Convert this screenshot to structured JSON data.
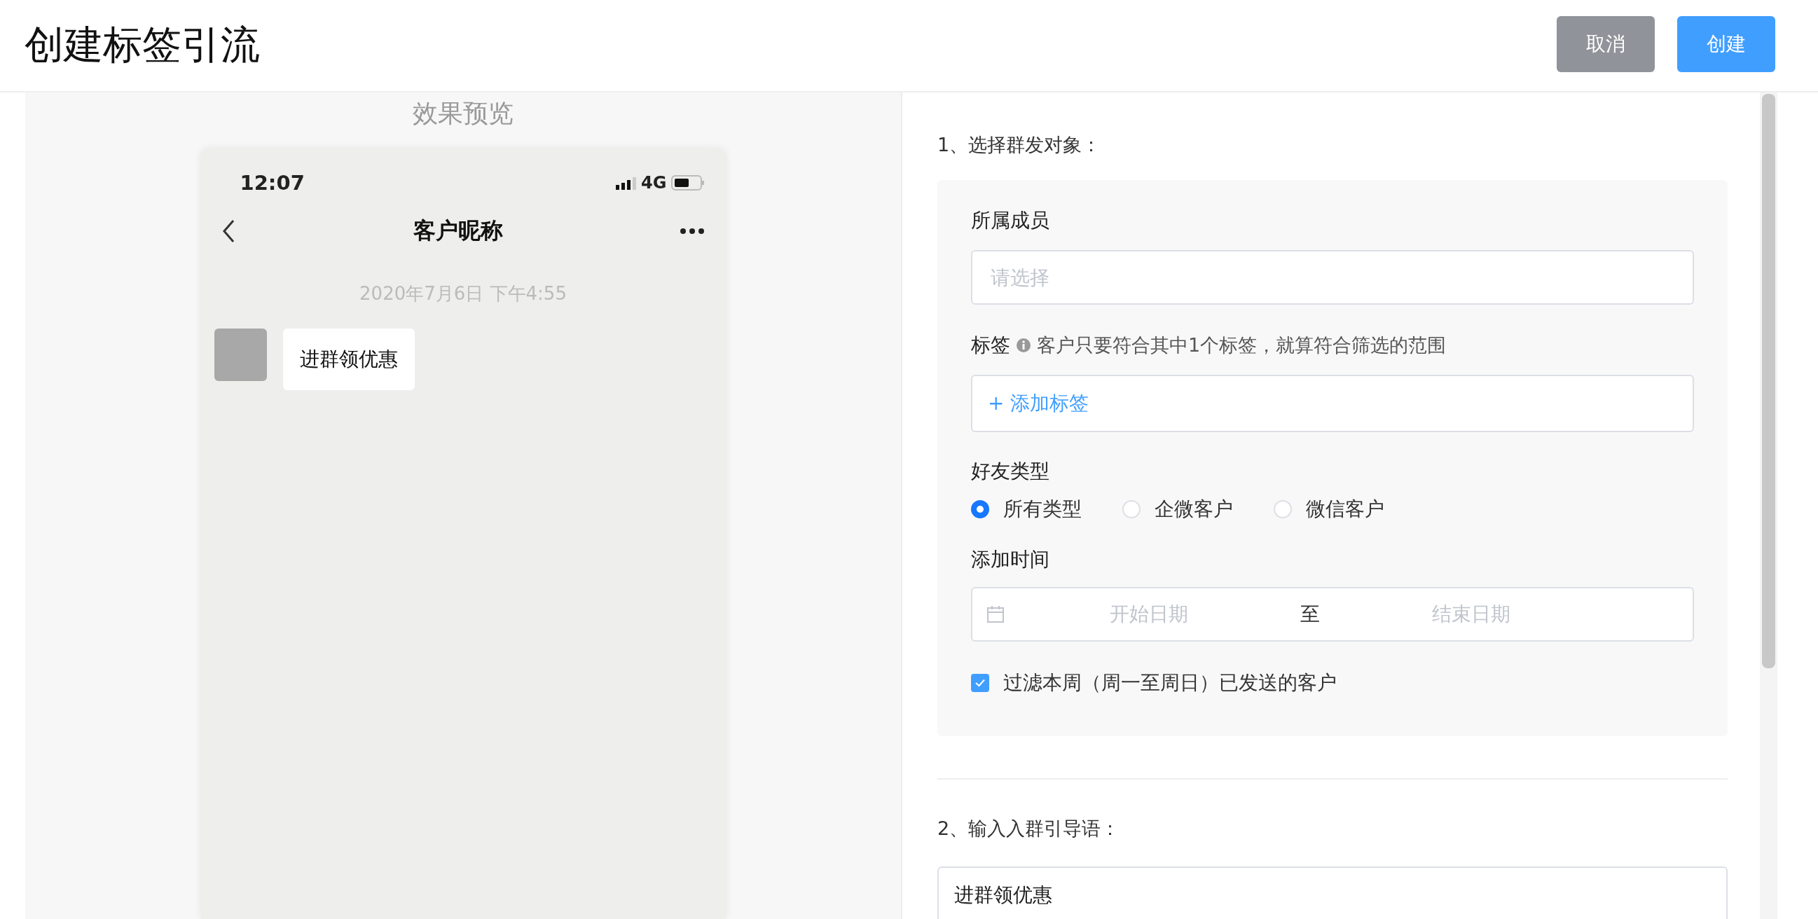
{
  "title": "创建标签引流",
  "buttons": [
    {
      "label": "取消",
      "kind": "cancel"
    },
    {
      "label": "创建",
      "kind": "primary"
    }
  ],
  "preview": {
    "heading": "效果预览",
    "phone": {
      "time": "12:07",
      "network": "4G",
      "chat_title": "客户昵称",
      "timestamp": "2020年7月6日 下午4:55",
      "message": "进群领优惠"
    }
  },
  "section1": {
    "title": "1、选择群发对象：",
    "member": {
      "label": "所属成员",
      "placeholder": "请选择"
    },
    "tags": {
      "label": "标签",
      "hint": "客户只要符合其中1个标签，就算符合筛选的范围",
      "add_label": "+ 添加标签"
    },
    "friend_type": {
      "label": "好友类型",
      "options": [
        {
          "label": "所有类型",
          "selected": true
        },
        {
          "label": "企微客户",
          "selected": false
        },
        {
          "label": "微信客户",
          "selected": false
        }
      ]
    },
    "add_time": {
      "label": "添加时间",
      "start_placeholder": "开始日期",
      "separator": "至",
      "end_placeholder": "结束日期"
    },
    "filter": {
      "label": "过滤本周（周一至周日）已发送的客户",
      "checked": true
    }
  },
  "section2": {
    "title": "2、输入入群引导语：",
    "value": "进群领优惠"
  }
}
